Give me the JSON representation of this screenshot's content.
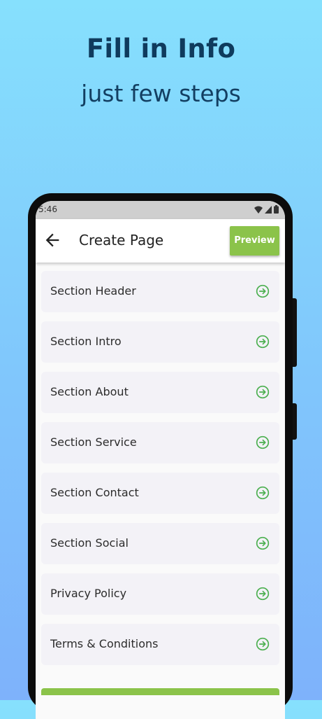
{
  "promo": {
    "title": "Fill in Info",
    "subtitle": "just few steps"
  },
  "status_bar": {
    "time": "5:46",
    "icons": [
      "wifi-icon",
      "signal-icon",
      "battery-icon"
    ]
  },
  "app_bar": {
    "title": "Create Page",
    "preview_label": "Preview",
    "back_icon": "arrow-left-icon"
  },
  "sections": [
    {
      "label": "Section Header"
    },
    {
      "label": "Section Intro"
    },
    {
      "label": "Section About"
    },
    {
      "label": "Section Service"
    },
    {
      "label": "Section Contact"
    },
    {
      "label": "Section Social"
    },
    {
      "label": "Privacy Policy"
    },
    {
      "label": "Terms & Conditions"
    }
  ],
  "colors": {
    "accent": "#8bc34a",
    "title": "#0f3b5d",
    "background_top": "#86e0fd",
    "background_bottom": "#7eb2fb"
  }
}
